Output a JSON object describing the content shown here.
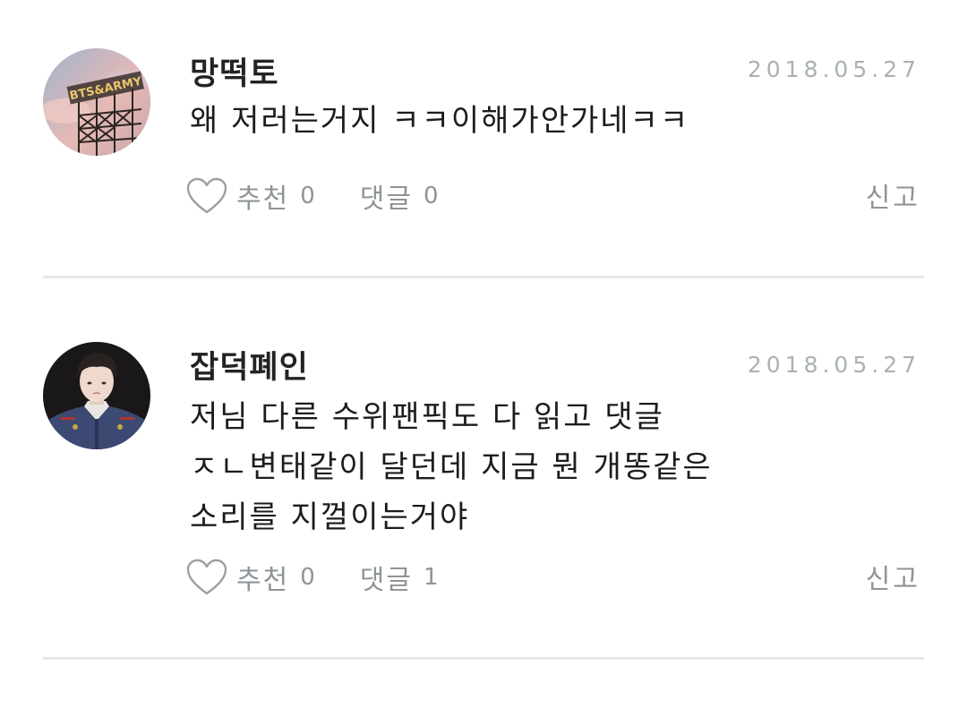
{
  "comments": [
    {
      "author": "망떡토",
      "date": "2018.05.27",
      "lines": [
        "왜 저러는거지 ㅋㅋ이해가안가네ㅋㅋ"
      ],
      "avatar_text": "BTS&ARMY",
      "like_label": "추천",
      "like_count": "0",
      "reply_label": "댓글",
      "reply_count": "0",
      "report_label": "신고"
    },
    {
      "author": "잡덕폐인",
      "date": "2018.05.27",
      "lines": [
        "저님 다른 수위팬픽도 다 읽고 댓글",
        "ㅈㄴ변태같이 달던데 지금 뭔 개똥같은",
        "소리를 지껄이는거야"
      ],
      "like_label": "추천",
      "like_count": "0",
      "reply_label": "댓글",
      "reply_count": "1",
      "report_label": "신고"
    }
  ],
  "colors": {
    "divider": "#e3e8eb",
    "muted_text": "#8e9498",
    "date_text": "#a9b1b5"
  },
  "icons": {
    "like": "heart-outline-icon"
  }
}
